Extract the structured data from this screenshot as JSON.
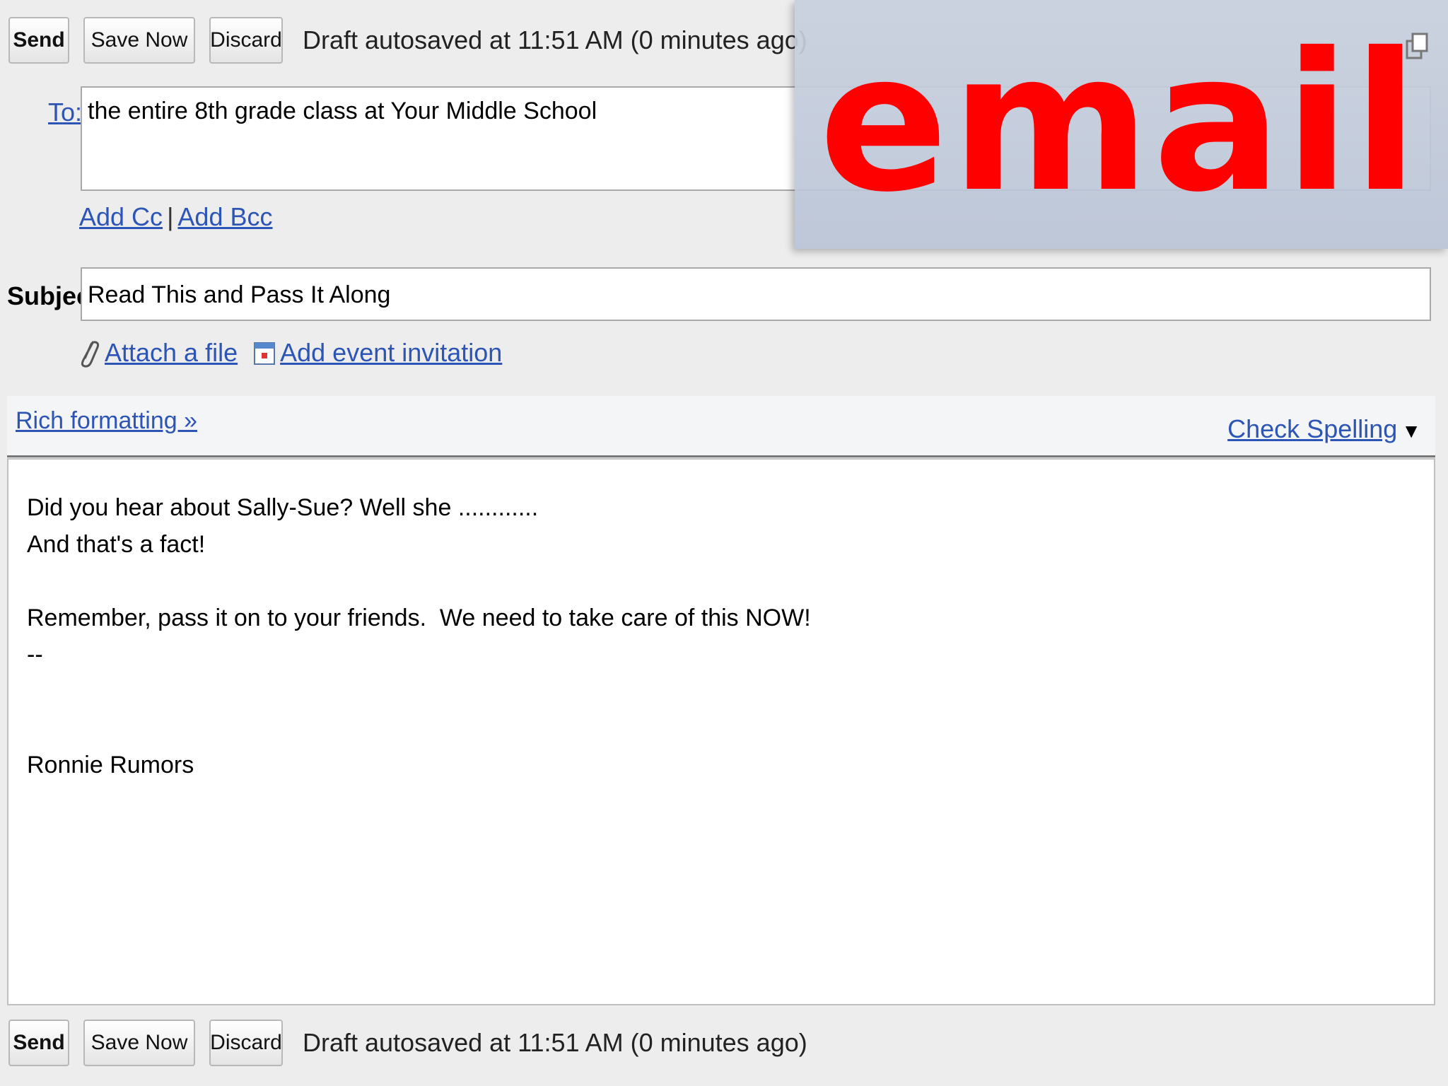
{
  "toolbar": {
    "send_label": "Send",
    "save_label": "Save Now",
    "discard_label": "Discard",
    "autosave_text": "Draft autosaved at 11:51 AM (0 minutes ago)"
  },
  "to": {
    "label": "To:",
    "value": "the entire 8th grade class at Your Middle School"
  },
  "cc_links": {
    "add_cc": "Add Cc",
    "separator": "|",
    "add_bcc": "Add Bcc"
  },
  "subject": {
    "label": "Subject:",
    "value": "Read This and Pass It Along"
  },
  "attachments": {
    "attach_label": "Attach a file",
    "event_label": "Add event invitation"
  },
  "format_bar": {
    "rich_label": "Rich formatting »",
    "spell_label": "Check Spelling",
    "spell_arrow": "▼"
  },
  "body": {
    "lines": [
      "Did you hear about Sally-Sue? Well she ............",
      "And that's a fact!",
      "",
      "Remember, pass it on to your friends.  We need to take care of this NOW!",
      "--",
      "",
      "",
      "Ronnie Rumors"
    ]
  },
  "overlay": {
    "word": "email",
    "color": "#ff0000"
  },
  "icons": {
    "popout": "popout-icon",
    "attach": "paperclip-icon",
    "event": "calendar-icon"
  },
  "colors": {
    "link": "#2c55b6"
  }
}
